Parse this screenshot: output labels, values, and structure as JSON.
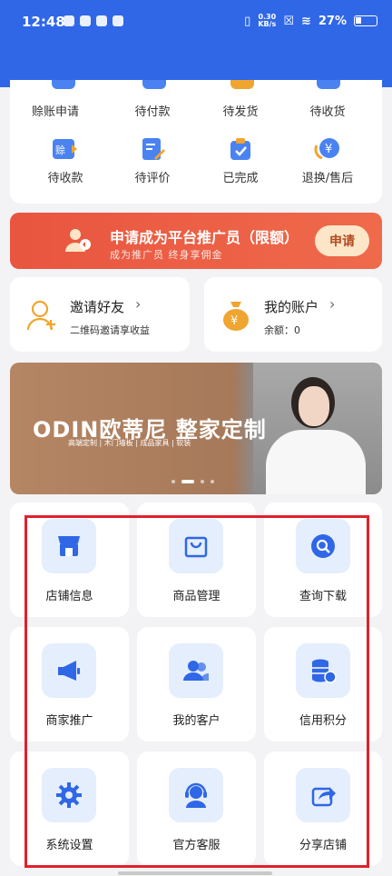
{
  "status_bar": {
    "time": "12:48",
    "speed_value": "0.30",
    "speed_unit": "KB/s",
    "battery": "27%"
  },
  "orders": [
    {
      "label": "赊账申请",
      "icon": "credit-apply-icon"
    },
    {
      "label": "待付款",
      "icon": "wallet-icon"
    },
    {
      "label": "待发货",
      "icon": "truck-icon"
    },
    {
      "label": "待收货",
      "icon": "box-icon"
    },
    {
      "label": "待收款",
      "icon": "credit-receive-icon"
    },
    {
      "label": "待评价",
      "icon": "edit-review-icon"
    },
    {
      "label": "已完成",
      "icon": "check-clipboard-icon"
    },
    {
      "label": "退换/售后",
      "icon": "refund-yen-icon"
    }
  ],
  "promo": {
    "title": "申请成为平台推广员（限额）",
    "subtitle": "成为推广员  终身享佣金",
    "button": "申请"
  },
  "invite": {
    "title": "邀请好友",
    "subtitle": "二维码邀请享收益"
  },
  "account": {
    "title": "我的账户",
    "subtitle": "余额：0"
  },
  "banner": {
    "logo": "ODIN欧蒂尼 整家定制",
    "tagline": "高端定制 | 木门墙板 | 成品家具 | 软装"
  },
  "tiles": [
    {
      "label": "店铺信息",
      "icon": "store-icon"
    },
    {
      "label": "商品管理",
      "icon": "shopping-bag-icon"
    },
    {
      "label": "查询下载",
      "icon": "search-icon"
    },
    {
      "label": "商家推广",
      "icon": "megaphone-icon"
    },
    {
      "label": "我的客户",
      "icon": "customers-icon"
    },
    {
      "label": "信用积分",
      "icon": "coins-icon"
    },
    {
      "label": "系统设置",
      "icon": "gear-icon"
    },
    {
      "label": "官方客服",
      "icon": "headset-icon"
    },
    {
      "label": "分享店铺",
      "icon": "share-icon"
    }
  ],
  "colors": {
    "brand_blue": "#2f67e7",
    "promo_red": "#e95540",
    "highlight_red": "#e0212b",
    "tile_icon_bg": "#e5eefc"
  }
}
